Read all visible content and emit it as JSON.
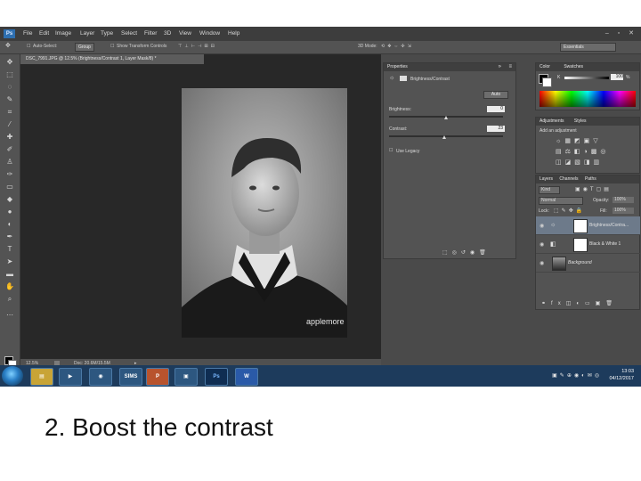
{
  "app": {
    "logo": "Ps"
  },
  "menu": [
    "File",
    "Edit",
    "Image",
    "Layer",
    "Type",
    "Select",
    "Filter",
    "3D",
    "View",
    "Window",
    "Help"
  ],
  "options": {
    "auto_select": "Auto-Select:",
    "group_value": "Group",
    "transform_controls": "Show Transform Controls",
    "mode_3d": "3D Mode:",
    "workspace": "Essentials"
  },
  "document": {
    "tab_title": "DSC_7991.JPG @ 12.5% (Brightness/Contrast 1, Layer Mask/8) *",
    "zoom": "12.5%",
    "doc_info": "Doc: 20.6M/15.5M",
    "watermark": "applemore"
  },
  "properties_panel": {
    "title": "Properties",
    "adjustment_name": "Brightness/Contrast",
    "auto_button": "Auto",
    "brightness_label": "Brightness:",
    "brightness_value": "0",
    "contrast_label": "Contrast:",
    "contrast_value": "23",
    "use_legacy": "Use Legacy"
  },
  "color_panel": {
    "tabs": [
      "Color",
      "Swatches"
    ],
    "k_label": "K",
    "k_value": "100",
    "percent": "%"
  },
  "adjustments_panel": {
    "tabs": [
      "Adjustments",
      "Styles"
    ],
    "subtitle": "Add an adjustment"
  },
  "layers_panel": {
    "tabs": [
      "Layers",
      "Channels",
      "Paths"
    ],
    "kind": "Kind",
    "blend_mode": "Normal",
    "opacity_label": "Opacity:",
    "opacity_value": "100%",
    "lock_label": "Lock:",
    "fill_label": "Fill:",
    "fill_value": "100%",
    "layers": [
      "Brightness/Contra...",
      "Black & White 1",
      "Background"
    ]
  },
  "taskbar": {
    "sims_label": "SIMS",
    "ps_label": "Ps",
    "word_label": "W",
    "time": "13:03",
    "date": "04/12/2017"
  },
  "caption": "2. Boost the contrast",
  "colors": {
    "accent_blue": "#2e6fb0",
    "panel_gray": "#535353",
    "canvas_dark": "#282828"
  }
}
